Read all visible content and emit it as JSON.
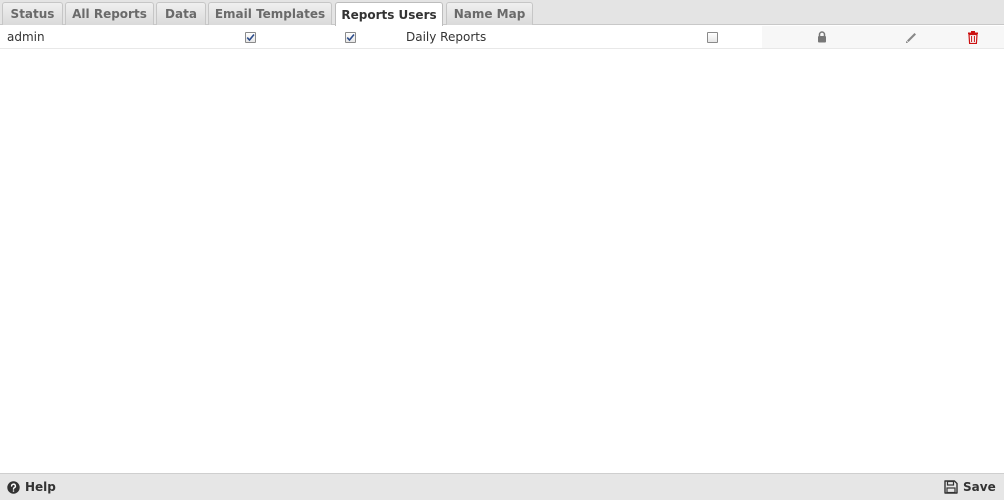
{
  "tabs": [
    {
      "label": "Status",
      "active": false
    },
    {
      "label": "All Reports",
      "active": false
    },
    {
      "label": "Data",
      "active": false
    },
    {
      "label": "Email Templates",
      "active": false
    },
    {
      "label": "Reports Users",
      "active": true
    },
    {
      "label": "Name Map",
      "active": false
    }
  ],
  "users": [
    {
      "name": "admin",
      "option1_checked": true,
      "option2_checked": true,
      "report": "Daily Reports",
      "option3_checked": false,
      "action_icons": [
        "lock-icon",
        "pencil-icon",
        "trash-icon"
      ]
    }
  ],
  "footer": {
    "help_label": "Help",
    "help_icon": "question-circle-icon",
    "save_label": "Save",
    "save_icon": "floppy-disk-icon"
  },
  "colors": {
    "tab_bar": "#e4e4e4",
    "active_tab": "#ffffff",
    "delete_icon": "#cc1111",
    "footer": "#e6e6e6"
  }
}
